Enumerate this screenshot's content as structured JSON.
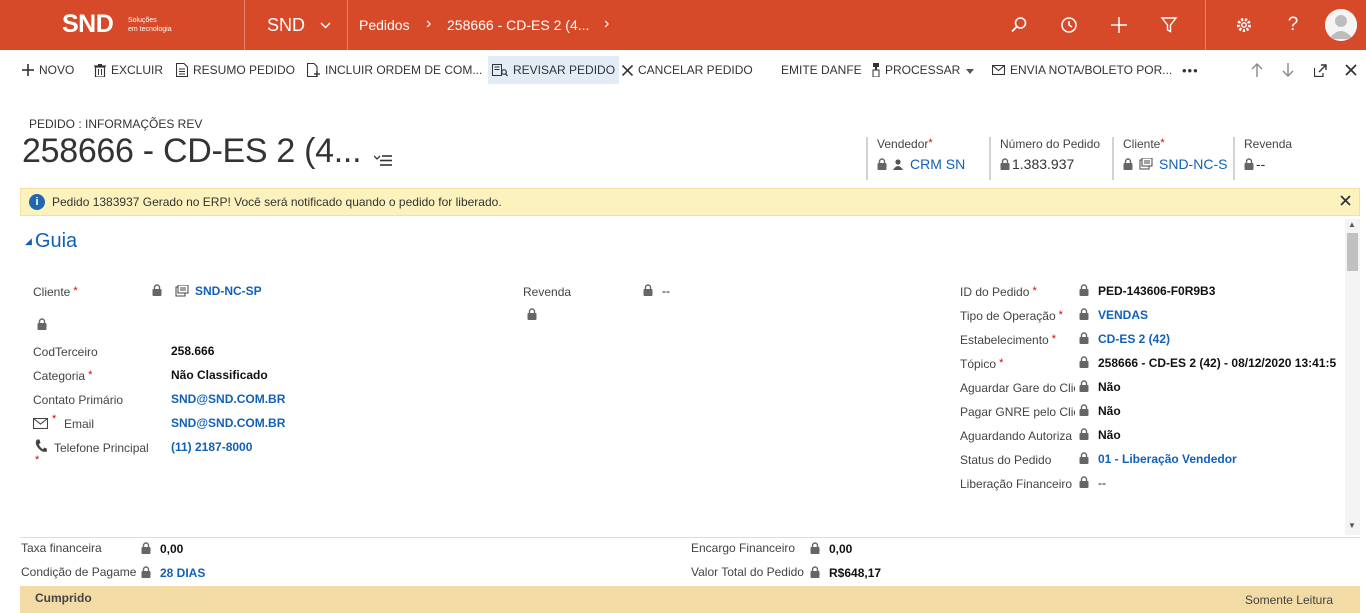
{
  "topbar": {
    "logo_text": "SND",
    "logo_sub_line1": "Soluções",
    "logo_sub_line2": "em tecnologia",
    "app_name": "SND",
    "breadcrumb_1": "Pedidos",
    "breadcrumb_sep": "›",
    "breadcrumb_2": "258666 - CD-ES 2 (4...",
    "icons": [
      "search-icon",
      "history-icon",
      "plus-icon",
      "filter-icon",
      "settings-icon",
      "help-icon",
      "avatar"
    ],
    "color": "#d64a2a"
  },
  "commands": {
    "novo": "NOVO",
    "excluir": "EXCLUIR",
    "resumo": "RESUMO PEDIDO",
    "incluir": "INCLUIR ORDEM DE COM...",
    "revisar": "REVISAR PEDIDO",
    "cancelar": "CANCELAR PEDIDO",
    "emitir": "EMITE DANFE",
    "processar": "PROCESSAR",
    "envia": "ENVIA NOTA/BOLETO POR...",
    "more": "•••"
  },
  "header": {
    "entity_label": "PEDIDO : INFORMAÇÕES REV",
    "title": "258666 - CD-ES 2 (4...",
    "fields": {
      "vendedor_label": "Vendedor",
      "vendedor_value": "CRM SN",
      "numero_label": "Número do Pedido",
      "numero_value": "1.383.937",
      "cliente_label": "Cliente",
      "cliente_value": "SND-NC-S",
      "revenda_label": "Revenda",
      "revenda_value": "--"
    }
  },
  "notice": {
    "text": "Pedido 1383937 Gerado no ERP! Você será notificado quando o pedido for liberado."
  },
  "section": {
    "title": "Guia"
  },
  "form": {
    "left": {
      "cliente_label": "Cliente",
      "cliente_value": "SND-NC-SP",
      "codterceiro_label": "CodTerceiro",
      "codterceiro_value": "258.666",
      "categoria_label": "Categoria",
      "categoria_value": "Não Classificado",
      "contato_label": "Contato Primário",
      "contato_value": "SND@SND.COM.BR",
      "email_label": "Email",
      "email_value": "SND@SND.COM.BR",
      "telefone_label": "Telefone Principal",
      "telefone_value": "(11) 2187-8000"
    },
    "middle": {
      "revenda_label": "Revenda",
      "revenda_value": "--"
    },
    "right": {
      "id_label": "ID do Pedido",
      "id_value": "PED-143606-F0R9B3",
      "tipo_label": "Tipo de Operação",
      "tipo_value": "VENDAS",
      "estab_label": "Estabelecimento",
      "estab_value": "CD-ES 2 (42)",
      "topico_label": "Tópico",
      "topico_value": "258666 - CD-ES 2 (42) - 08/12/2020 13:41:5",
      "gare_label": "Aguardar Gare do Clie",
      "gare_value": "Não",
      "gnre_label": "Pagar GNRE pelo Clie",
      "gnre_value": "Não",
      "autoriz_label": "Aguardando Autoriza",
      "autoriz_value": "Não",
      "status_label": "Status do Pedido",
      "status_value": "01 - Liberação Vendedor",
      "liberacao_label": "Liberação Financeiro",
      "liberacao_value": "--"
    }
  },
  "footer": {
    "taxa_label": "Taxa financeira",
    "taxa_value": "0,00",
    "condicao_label": "Condição de Pagamer",
    "condicao_value": "28 DIAS",
    "encargo_label": "Encargo Financeiro",
    "encargo_value": "0,00",
    "valor_label": "Valor Total do Pedido",
    "valor_value": "R$648,17"
  },
  "statusbar": {
    "left": "Cumprido",
    "right": "Somente Leitura",
    "color": "#f2dba5"
  }
}
